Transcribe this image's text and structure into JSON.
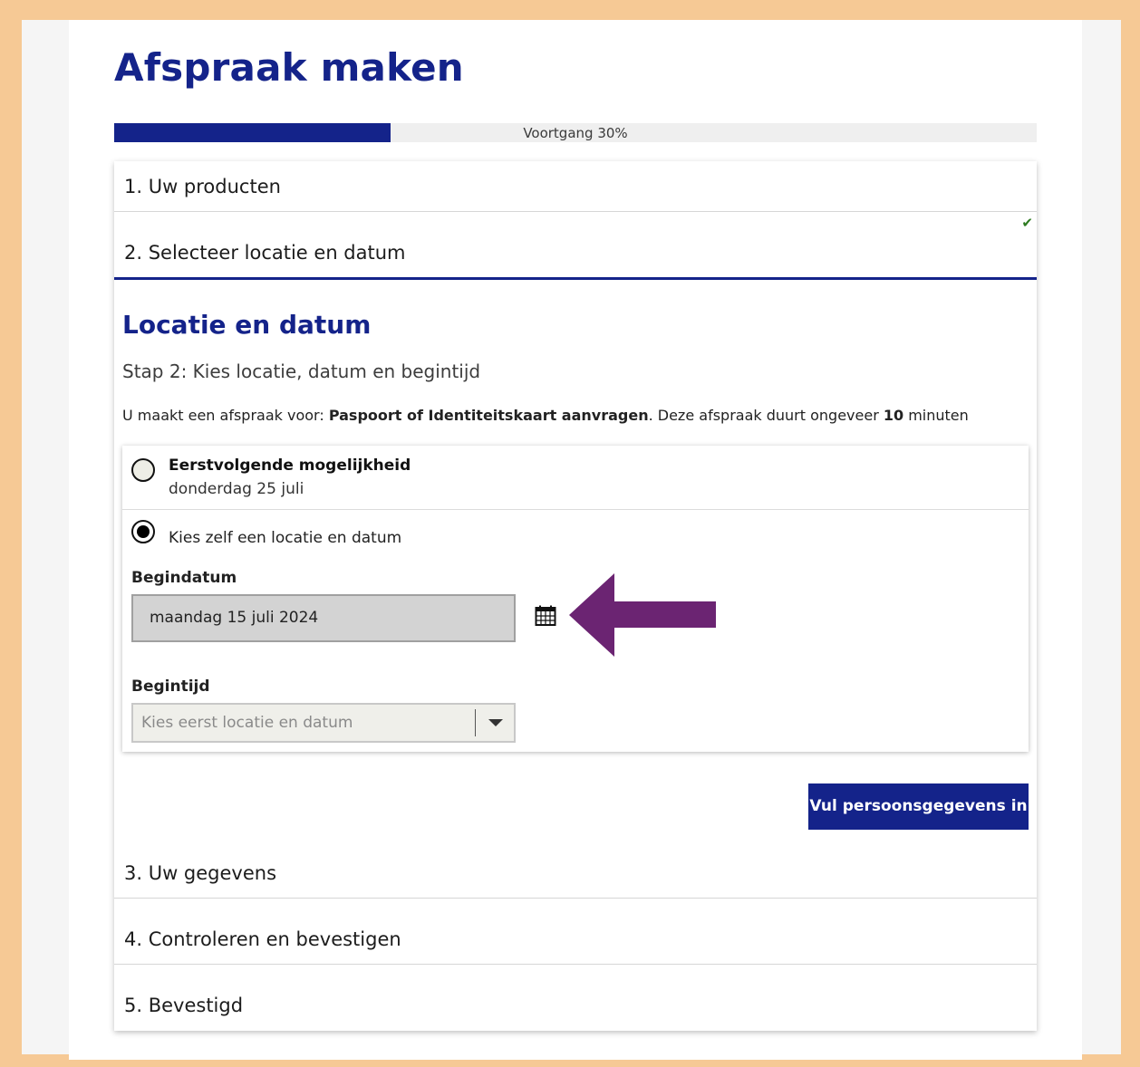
{
  "page": {
    "title": "Afspraak maken"
  },
  "progress": {
    "label": "Voortgang 30%",
    "fraction": 0.3
  },
  "steps": [
    {
      "label": "1. Uw producten",
      "completed": true
    },
    {
      "label": "2. Selecteer locatie en datum",
      "active": true
    },
    {
      "label": "3. Uw gegevens"
    },
    {
      "label": "4. Controleren en bevestigen"
    },
    {
      "label": "5. Bevestigd"
    }
  ],
  "section": {
    "title": "Locatie en datum",
    "subtitle": "Stap 2: Kies locatie, datum en begintijd",
    "info_prefix": "U maakt een afspraak voor: ",
    "info_product": "Paspoort of Identiteitskaart aanvragen",
    "info_middle": ". Deze afspraak duurt ongeveer ",
    "info_duration": "10",
    "info_suffix": " minuten"
  },
  "options": {
    "first_title": "Eerstvolgende mogelijkheid",
    "first_date": "donderdag 25 juli",
    "custom_label": "Kies zelf een locatie en datum",
    "selected": "custom"
  },
  "form": {
    "start_date_label": "Begindatum",
    "start_date_value": "maandag 15 juli 2024",
    "start_time_label": "Begintijd",
    "start_time_placeholder": "Kies eerst locatie en datum"
  },
  "actions": {
    "next_label": "Vul persoonsgegevens in"
  },
  "icons": {
    "completed": "check-icon",
    "calendar": "calendar-icon",
    "annotation": "arrow-left-icon",
    "dropdown": "chevron-down-icon"
  },
  "colors": {
    "brand": "#14238a",
    "annotation_arrow": "#6b2472",
    "frame": "#f6c995",
    "check": "#2c7a1f"
  }
}
